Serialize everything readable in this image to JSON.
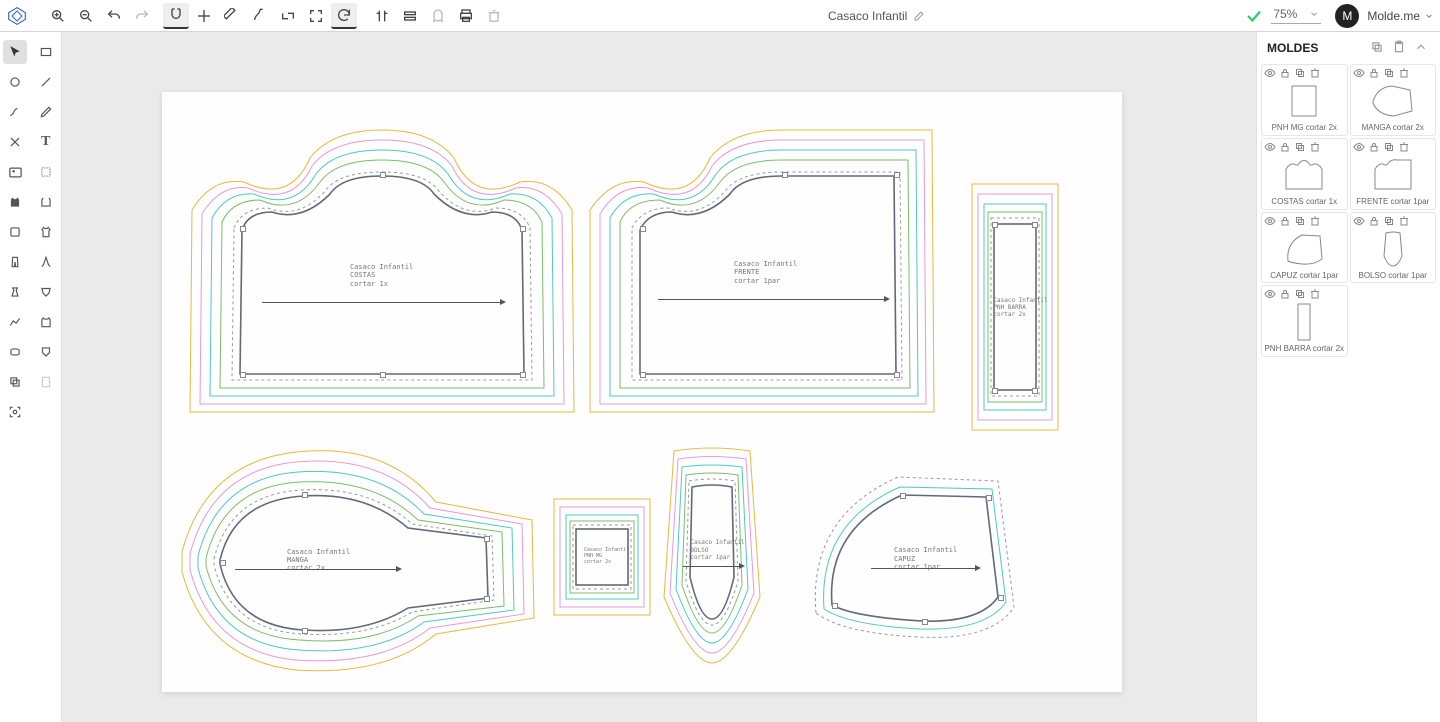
{
  "title": "Casaco Infantil",
  "zoom": "75%",
  "user": {
    "initial": "M",
    "name": "Molde.me"
  },
  "panel": {
    "header": "MOLDES"
  },
  "items": [
    {
      "label": "PNH MG cortar 2x"
    },
    {
      "label": "MANGA cortar 2x"
    },
    {
      "label": "COSTAS cortar 1x"
    },
    {
      "label": "FRENTE cortar 1par"
    },
    {
      "label": "CAPUZ cortar 1par"
    },
    {
      "label": "BOLSO cortar 1par"
    },
    {
      "label": "PNH BARRA cortar 2x"
    }
  ],
  "pieces": {
    "costas": {
      "t1": "Casaco Infantil",
      "t2": "COSTAS",
      "t3": "cortar 1x"
    },
    "frente": {
      "t1": "Casaco Infantil",
      "t2": "FRENTE",
      "t3": "cortar 1par"
    },
    "pnhbarra": {
      "t1": "Casaco Infantil",
      "t2": "PNH BARRA",
      "t3": "cortar 2x"
    },
    "manga": {
      "t1": "Casaco Infantil",
      "t2": "MANGA",
      "t3": "cortar 2x"
    },
    "pnhmg": {
      "t1": "Casaco Infantil",
      "t2": "PNH MG",
      "t3": "cortar 2x"
    },
    "bolso": {
      "t1": "Casaco Infantil",
      "t2": "BOLSO",
      "t3": "cortar 1par"
    },
    "capuz": {
      "t1": "Casaco Infantil",
      "t2": "CAPUZ",
      "t3": "cortar 1par"
    }
  },
  "grade_colors": [
    "#e6b93f",
    "#e89bd2",
    "#4fc9c2",
    "#7bbf6a",
    "#5f6a7a",
    "#d5d5d5",
    "#5f6a7a",
    "#4fc9c2",
    "#d6a3d6",
    "#e6b93f"
  ]
}
